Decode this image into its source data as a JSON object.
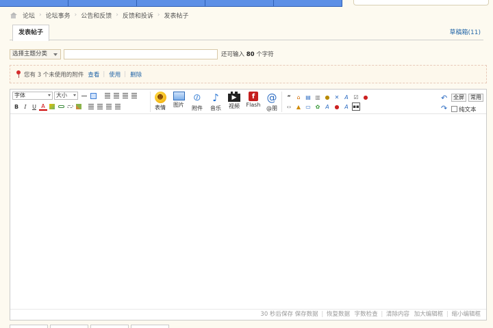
{
  "breadcrumb": {
    "items": [
      "论坛",
      "论坛事务",
      "公告和反馈",
      "反馈和投诉",
      "发表帖子"
    ]
  },
  "tabs": {
    "active": "发表帖子",
    "draft": "草稿箱(11)"
  },
  "subject": {
    "type_select": "选择主题分类",
    "input_value": "",
    "hint_prefix": "还可输入",
    "hint_count": "80",
    "hint_suffix": "个字符"
  },
  "attach_notice": {
    "text": "您有 3 个未使用的附件",
    "view": "查看",
    "use": "使用",
    "delete": "删除"
  },
  "toolbar": {
    "font_select": "字体",
    "size_select": "大小",
    "bold": "B",
    "italic": "I",
    "underline": "U",
    "color": "A",
    "emoji": "表情",
    "image": "图片",
    "attachment": "附件",
    "music": "音乐",
    "video": "视频",
    "flash": "Flash",
    "at": "@朋",
    "fullscreen": "全屏",
    "common": "常用",
    "plaintext": "纯文本"
  },
  "statusbar": {
    "autosave": "30 秒后保存",
    "save": "保存数据",
    "restore": "恢复数据",
    "wordcount": "字数检查",
    "clear": "清除内容",
    "enlarge": "加大编辑框",
    "shrink": "缩小编辑框"
  },
  "colors": {
    "nav_blue": "#5c8fe6",
    "link_blue": "#2366a8",
    "page_bg": "#fdfaf0"
  }
}
